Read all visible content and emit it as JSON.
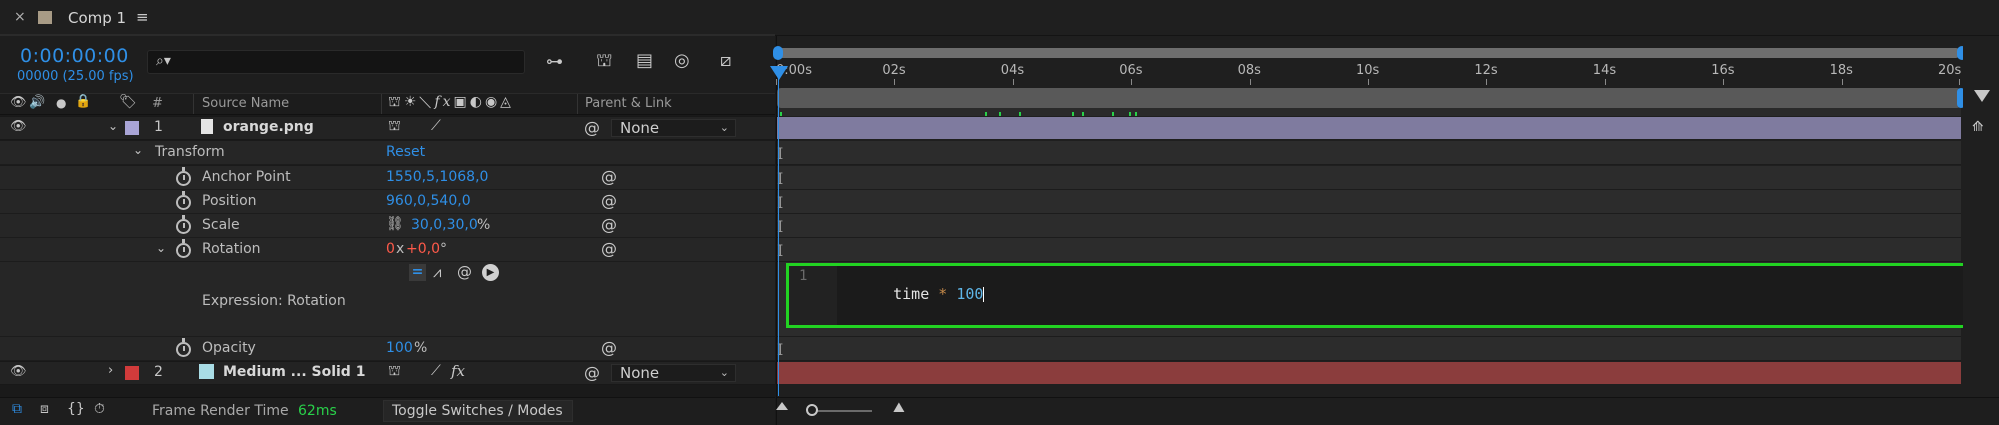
{
  "tab": {
    "close": "×",
    "title": "Comp 1",
    "menu": "≡"
  },
  "timecode": {
    "value": "0:00:00:00",
    "frames": "00000 (25.00 fps)"
  },
  "search": {
    "placeholder": ""
  },
  "columns": {
    "hash": "#",
    "source_name": "Source Name",
    "parent_link": "Parent & Link"
  },
  "layers": [
    {
      "index": "1",
      "name": "orange.png",
      "label_color": "#a9a4d6",
      "parent": "None",
      "expanded": true
    },
    {
      "index": "2",
      "name": "Medium ... Solid 1",
      "label_color": "#d13b3b",
      "parent": "None",
      "expanded": false
    }
  ],
  "transform": {
    "label": "Transform",
    "reset": "Reset",
    "anchor_point": {
      "label": "Anchor Point",
      "value": "1550,5,1068,0"
    },
    "position": {
      "label": "Position",
      "value": "960,0,540,0"
    },
    "scale": {
      "label": "Scale",
      "value": "30,0,30,0",
      "unit": "%"
    },
    "rotation": {
      "label": "Rotation",
      "revolutions": "0",
      "x": "x",
      "degrees": "+0,0",
      "unit": "°"
    },
    "expression_label": "Expression: Rotation",
    "opacity": {
      "label": "Opacity",
      "value": "100",
      "unit": "%"
    }
  },
  "expression": {
    "line_number": "1",
    "code_ident": "time",
    "code_op": " * ",
    "code_num": "100"
  },
  "ruler": {
    "labels": [
      "0:00s",
      "02s",
      "04s",
      "06s",
      "08s",
      "10s",
      "12s",
      "14s",
      "16s",
      "18s",
      "20s"
    ]
  },
  "footer": {
    "render_label": "Frame Render Time",
    "render_value": "62ms",
    "toggle": "Toggle Switches / Modes"
  },
  "colors": {
    "accent_blue": "#2f8fe6",
    "layer1_bar": "#7f7b9f",
    "layer2_bar": "#8b3d3d",
    "expression_border": "#22d322",
    "keyframe_green": "#29d14a"
  }
}
